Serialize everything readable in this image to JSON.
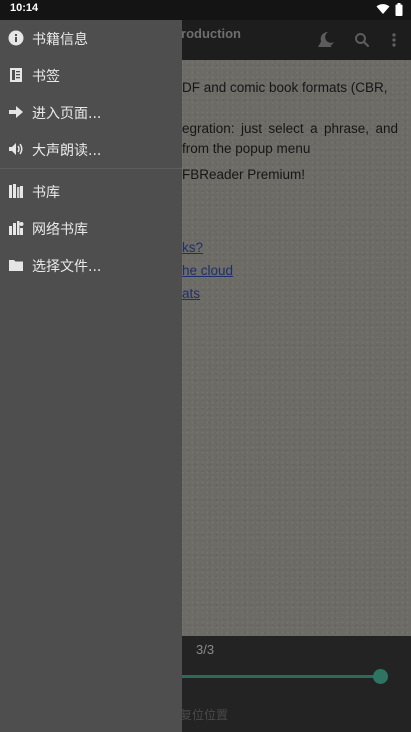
{
  "status_bar": {
    "time": "10:14",
    "icons": [
      "wifi-icon",
      "battery-icon"
    ]
  },
  "toolbar": {
    "title": "anIntroduction",
    "icons": [
      "day-night-icon",
      "search-icon",
      "more-icon"
    ]
  },
  "book": {
    "paragraphs": [
      "DF and comic book formats (CBR,",
      "egration: just select a phrase, and from the popup menu",
      "FBReader Premium!"
    ],
    "links": [
      "ks?",
      "he cloud",
      "ats"
    ]
  },
  "navigation": {
    "page_counter": "3/3",
    "progress": 1.0,
    "reset_label": "复位位置"
  },
  "drawer": {
    "items": [
      {
        "label": "书籍信息",
        "icon": "info-icon"
      },
      {
        "label": "书签",
        "icon": "bookmark-icon"
      },
      {
        "label": "进入页面...",
        "icon": "arrow-right-icon"
      },
      {
        "label": "大声朗读...",
        "icon": "speaker-icon"
      },
      {
        "label": "书库",
        "icon": "library-icon"
      },
      {
        "label": "网络书库",
        "icon": "network-library-icon"
      },
      {
        "label": "选择文件...",
        "icon": "folder-icon"
      }
    ]
  },
  "colors": {
    "drawer_bg": "#4e4e4e",
    "page_bg": "#6d6b66",
    "accent": "#2f7462",
    "link": "#1f2f6b"
  }
}
